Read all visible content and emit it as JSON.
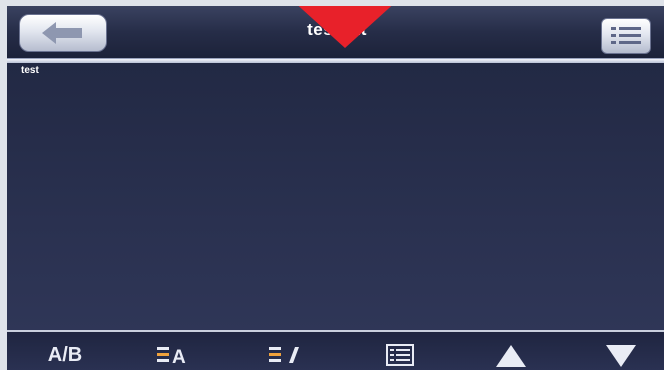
{
  "header": {
    "title": "test.txt",
    "back_icon": "back-arrow-icon",
    "menu_icon": "list-menu-icon",
    "marker_color": "#e8212a"
  },
  "document": {
    "content": "test"
  },
  "toolbar": {
    "ab_label": "A/B",
    "font_color_icon": "text-color-icon",
    "font_style_icon": "text-italic-icon",
    "list_icon": "list-view-icon",
    "up_icon": "page-up-icon",
    "down_icon": "page-down-icon"
  },
  "colors": {
    "background": "#232a45",
    "accent_orange": "#f0a23c"
  }
}
